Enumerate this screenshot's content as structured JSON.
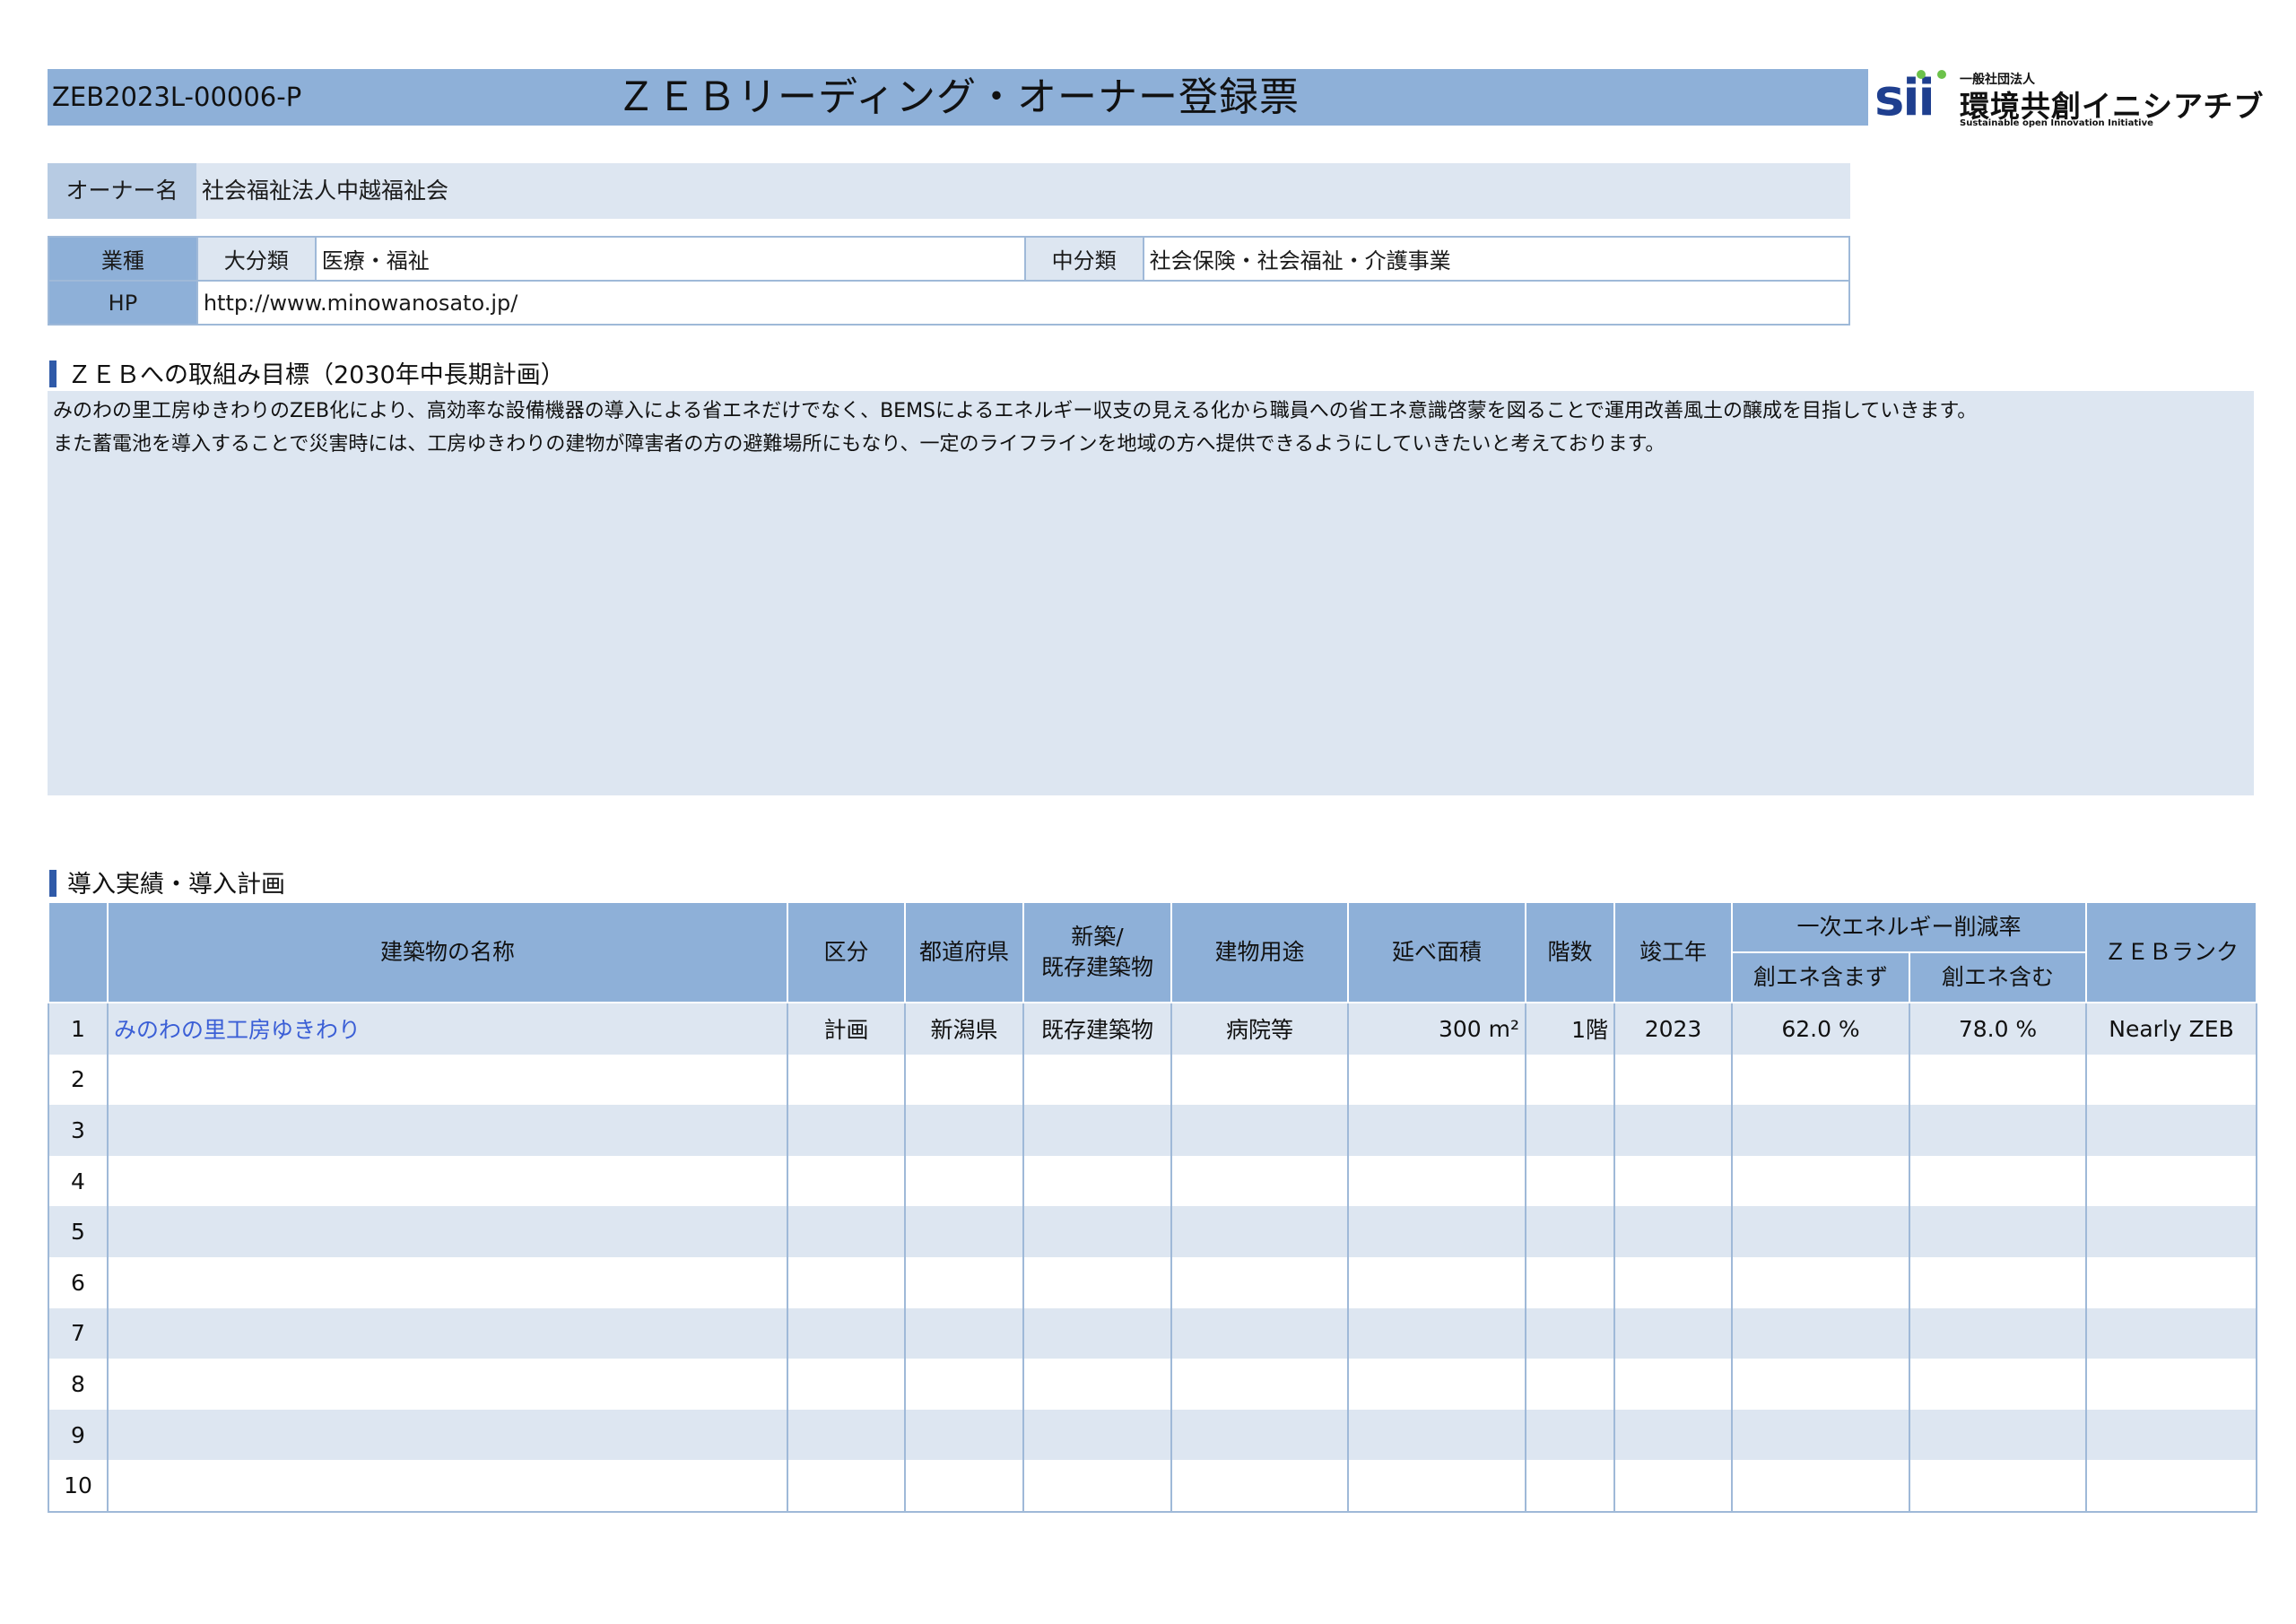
{
  "header": {
    "doc_id": "ZEB2023L-00006-P",
    "title": "ＺＥＢリーディング・オーナー登録票"
  },
  "logo": {
    "mark": "sii",
    "small": "一般社団法人",
    "main": "環境共創イニシアチブ",
    "english": "Sustainable open Innovation Initiative"
  },
  "owner": {
    "label": "オーナー名",
    "value": "社会福祉法人中越福祉会"
  },
  "industry": {
    "label": "業種",
    "major_label": "大分類",
    "major_value": "医療・福祉",
    "middle_label": "中分類",
    "middle_value": "社会保険・社会福祉・介護事業"
  },
  "hp": {
    "label": "HP",
    "value": "http://www.minowanosato.jp/"
  },
  "goal": {
    "heading": "ＺＥＢへの取組み目標（2030年中長期計画）",
    "lines": [
      "みのわの里工房ゆきわりのZEB化により、高効率な設備機器の導入による省エネだけでなく、BEMSによるエネルギー収支の見える化から職員への省エネ意識啓蒙を図ることで運用改善風土の醸成を目指していきます。",
      "また蓄電池を導入することで災害時には、工房ゆきわりの建物が障害者の方の避難場所にもなり、一定のライフラインを地域の方へ提供できるようにしていきたいと考えております。"
    ]
  },
  "plan": {
    "heading": "導入実績・導入計画",
    "columns": {
      "name": "建築物の名称",
      "kubun": "区分",
      "pref": "都道府県",
      "new_existing_1": "新築/",
      "new_existing_2": "既存建築物",
      "use": "建物用途",
      "area": "延べ面積",
      "floors": "階数",
      "year": "竣工年",
      "reduction": "一次エネルギー削減率",
      "red_excl": "創エネ含まず",
      "red_incl": "創エネ含む",
      "rank": "ＺＥＢランク"
    },
    "rows": [
      {
        "no": "1",
        "name": "みのわの里工房ゆきわり",
        "kubun": "計画",
        "pref": "新潟県",
        "type": "既存建築物",
        "use": "病院等",
        "area": "300 m²",
        "floors": "1階",
        "year": "2023",
        "red_excl": "62.0 %",
        "red_incl": "78.0 %",
        "rank": "Nearly ZEB"
      },
      {
        "no": "2"
      },
      {
        "no": "3"
      },
      {
        "no": "4"
      },
      {
        "no": "5"
      },
      {
        "no": "6"
      },
      {
        "no": "7"
      },
      {
        "no": "8"
      },
      {
        "no": "9"
      },
      {
        "no": "10"
      }
    ]
  }
}
